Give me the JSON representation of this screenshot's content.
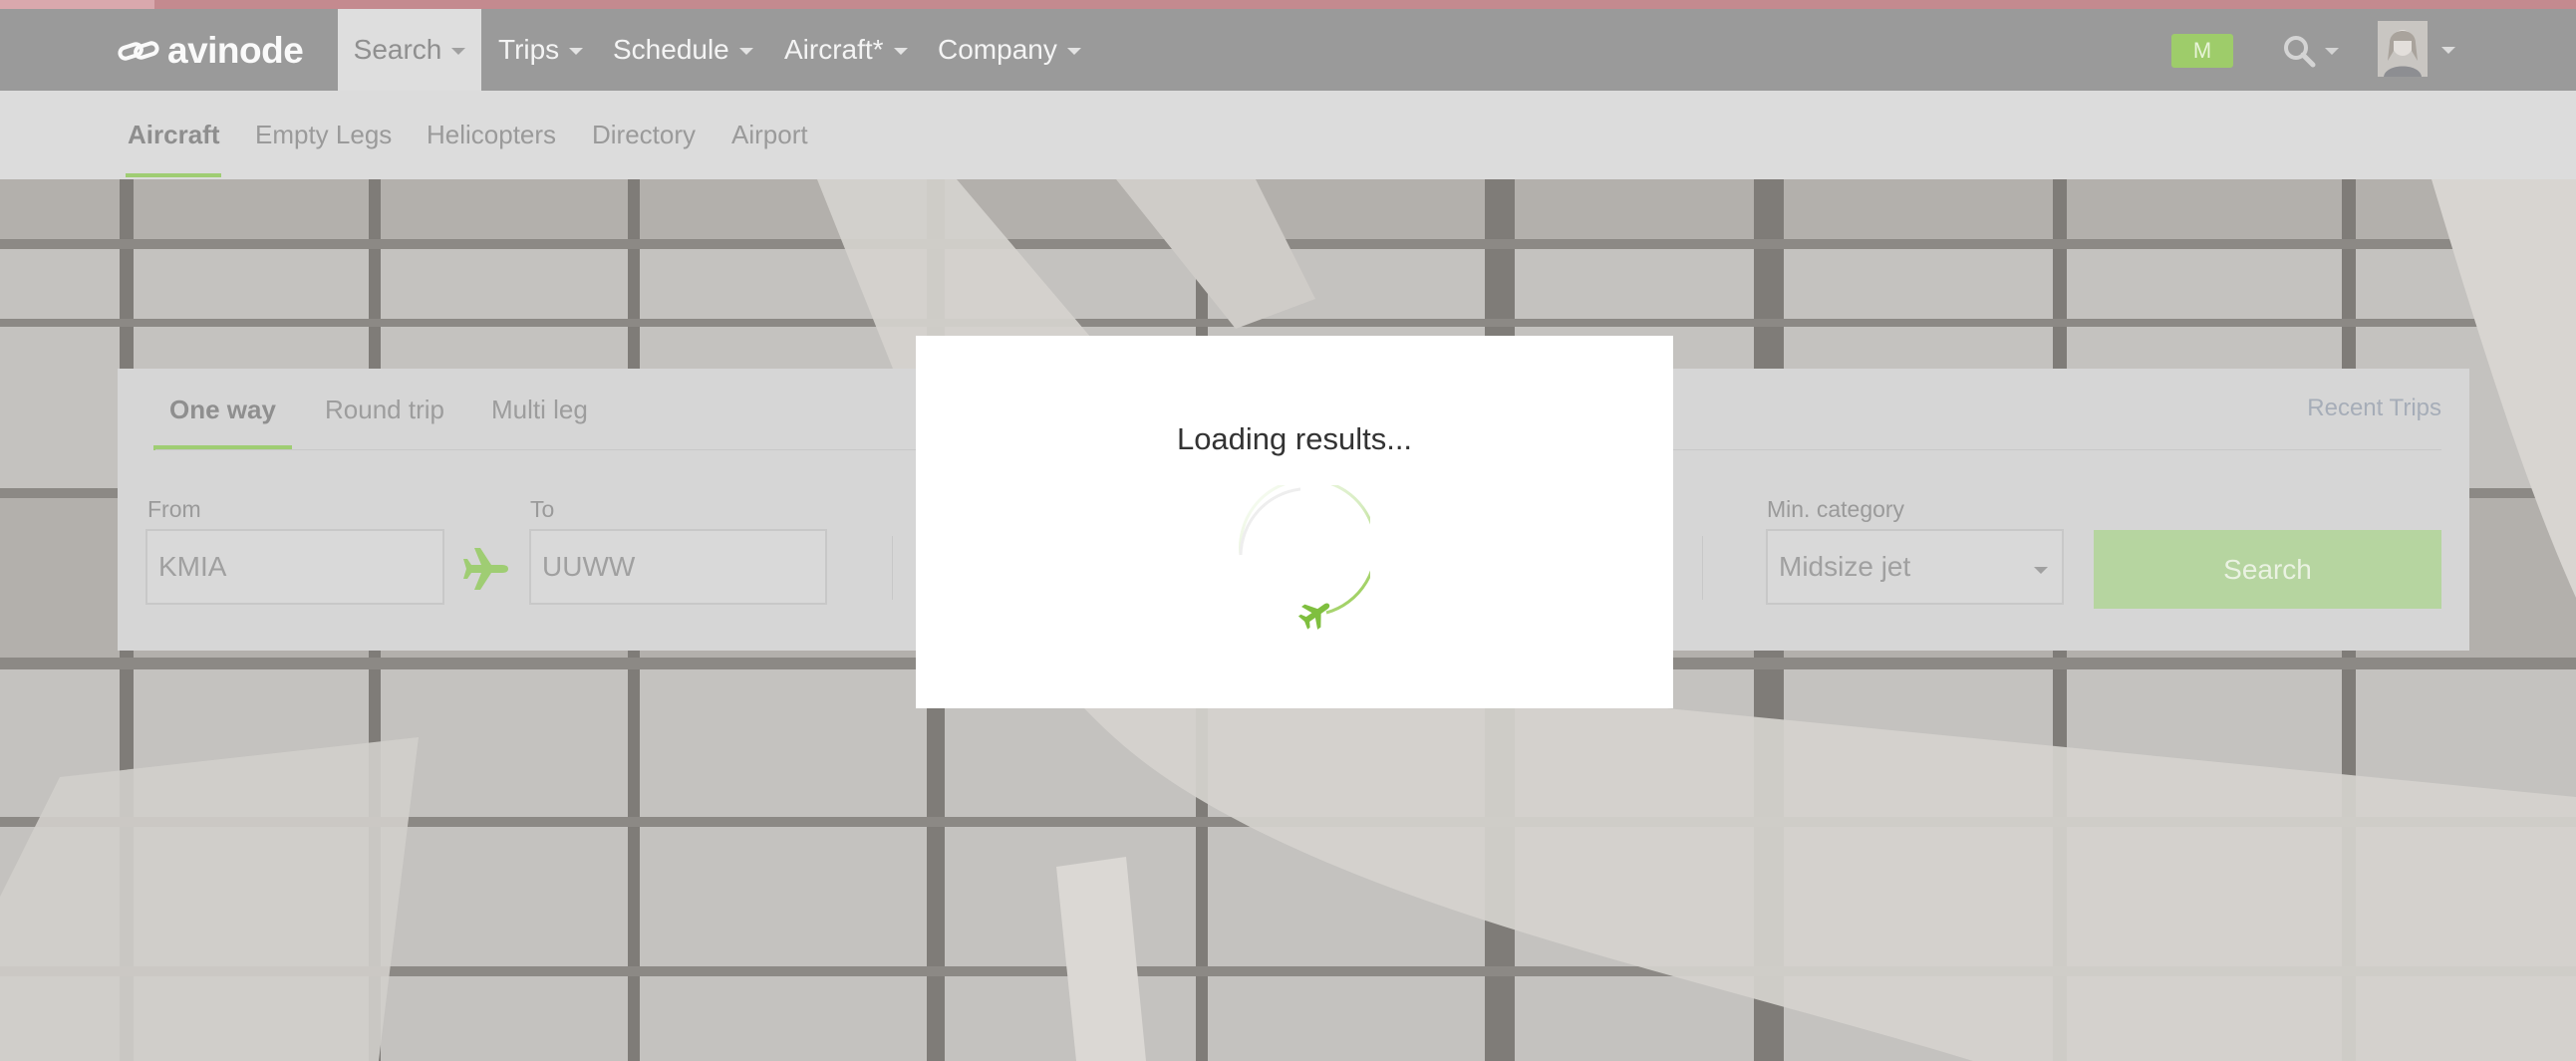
{
  "brand": {
    "name": "avinode"
  },
  "colors": {
    "accent_green": "#8cc63f",
    "navbar_bg": "#9a9a9a",
    "subnav_bg": "#dcdcdc",
    "modal_bg": "#ffffff",
    "top_stripe": "#c48a8f"
  },
  "navbar": {
    "items": [
      {
        "label": "Search",
        "active": true
      },
      {
        "label": "Trips"
      },
      {
        "label": "Schedule"
      },
      {
        "label": "Aircraft*"
      },
      {
        "label": "Company"
      }
    ],
    "badge": "M",
    "search_icon": "magnifier-icon",
    "avatar_icon": "user-avatar"
  },
  "subnav": {
    "items": [
      {
        "label": "Aircraft",
        "active": true
      },
      {
        "label": "Empty Legs"
      },
      {
        "label": "Helicopters"
      },
      {
        "label": "Directory"
      },
      {
        "label": "Airport"
      }
    ]
  },
  "search_panel": {
    "tabs": [
      {
        "label": "One way",
        "active": true
      },
      {
        "label": "Round trip"
      },
      {
        "label": "Multi leg"
      }
    ],
    "recent_trips": "Recent Trips",
    "from": {
      "label": "From",
      "value": "KMIA"
    },
    "to": {
      "label": "To",
      "value": "UUWW"
    },
    "min_category": {
      "label": "Min. category",
      "value": "Midsize jet"
    },
    "search_button": "Search"
  },
  "modal": {
    "message": "Loading results...",
    "spinner_icon": "plane-loading-spinner-icon"
  }
}
